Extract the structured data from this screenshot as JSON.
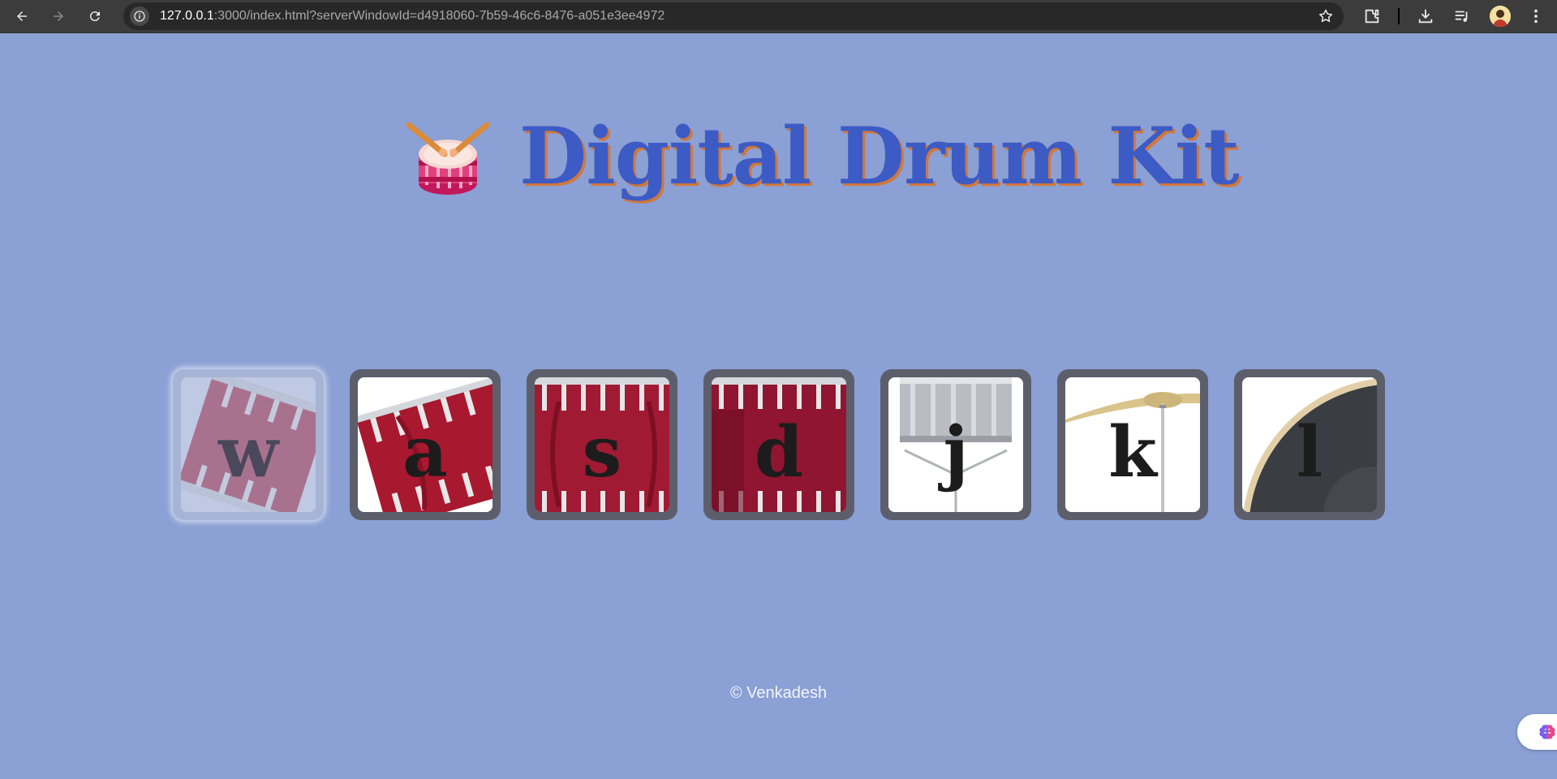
{
  "browser": {
    "url_host": "127.0.0.1",
    "url_rest": ":3000/index.html?serverWindowId=d4918060-7b59-46c6-8476-a051e3ee4972",
    "back_icon": "arrow-left-icon",
    "forward_icon": "arrow-right-icon",
    "reload_icon": "reload-icon",
    "site_info_icon": "info-icon",
    "bookmark_icon": "star-icon",
    "toolbar_icons": [
      "extensions-icon",
      "download-icon",
      "reading-list-icon",
      "profile-avatar",
      "more-vert-icon"
    ]
  },
  "page": {
    "title": "Digital Drum Kit",
    "title_emoji": "drum-icon",
    "footer": "© Venkadesh",
    "colors": {
      "background": "#8ba0d4",
      "title": "#3d5bc4",
      "title_shadow": "#d2773a",
      "key_frame": "#5c5f6b"
    }
  },
  "keys": [
    {
      "letter": "w",
      "drum": "crash",
      "pressed": true
    },
    {
      "letter": "a",
      "drum": "kick",
      "pressed": false
    },
    {
      "letter": "s",
      "drum": "snare",
      "pressed": false
    },
    {
      "letter": "d",
      "drum": "tom1",
      "pressed": false
    },
    {
      "letter": "j",
      "drum": "tom2",
      "pressed": false
    },
    {
      "letter": "k",
      "drum": "cymbal",
      "pressed": false
    },
    {
      "letter": "l",
      "drum": "bass",
      "pressed": false
    }
  ],
  "floating_button": {
    "icon": "brain-icon"
  }
}
